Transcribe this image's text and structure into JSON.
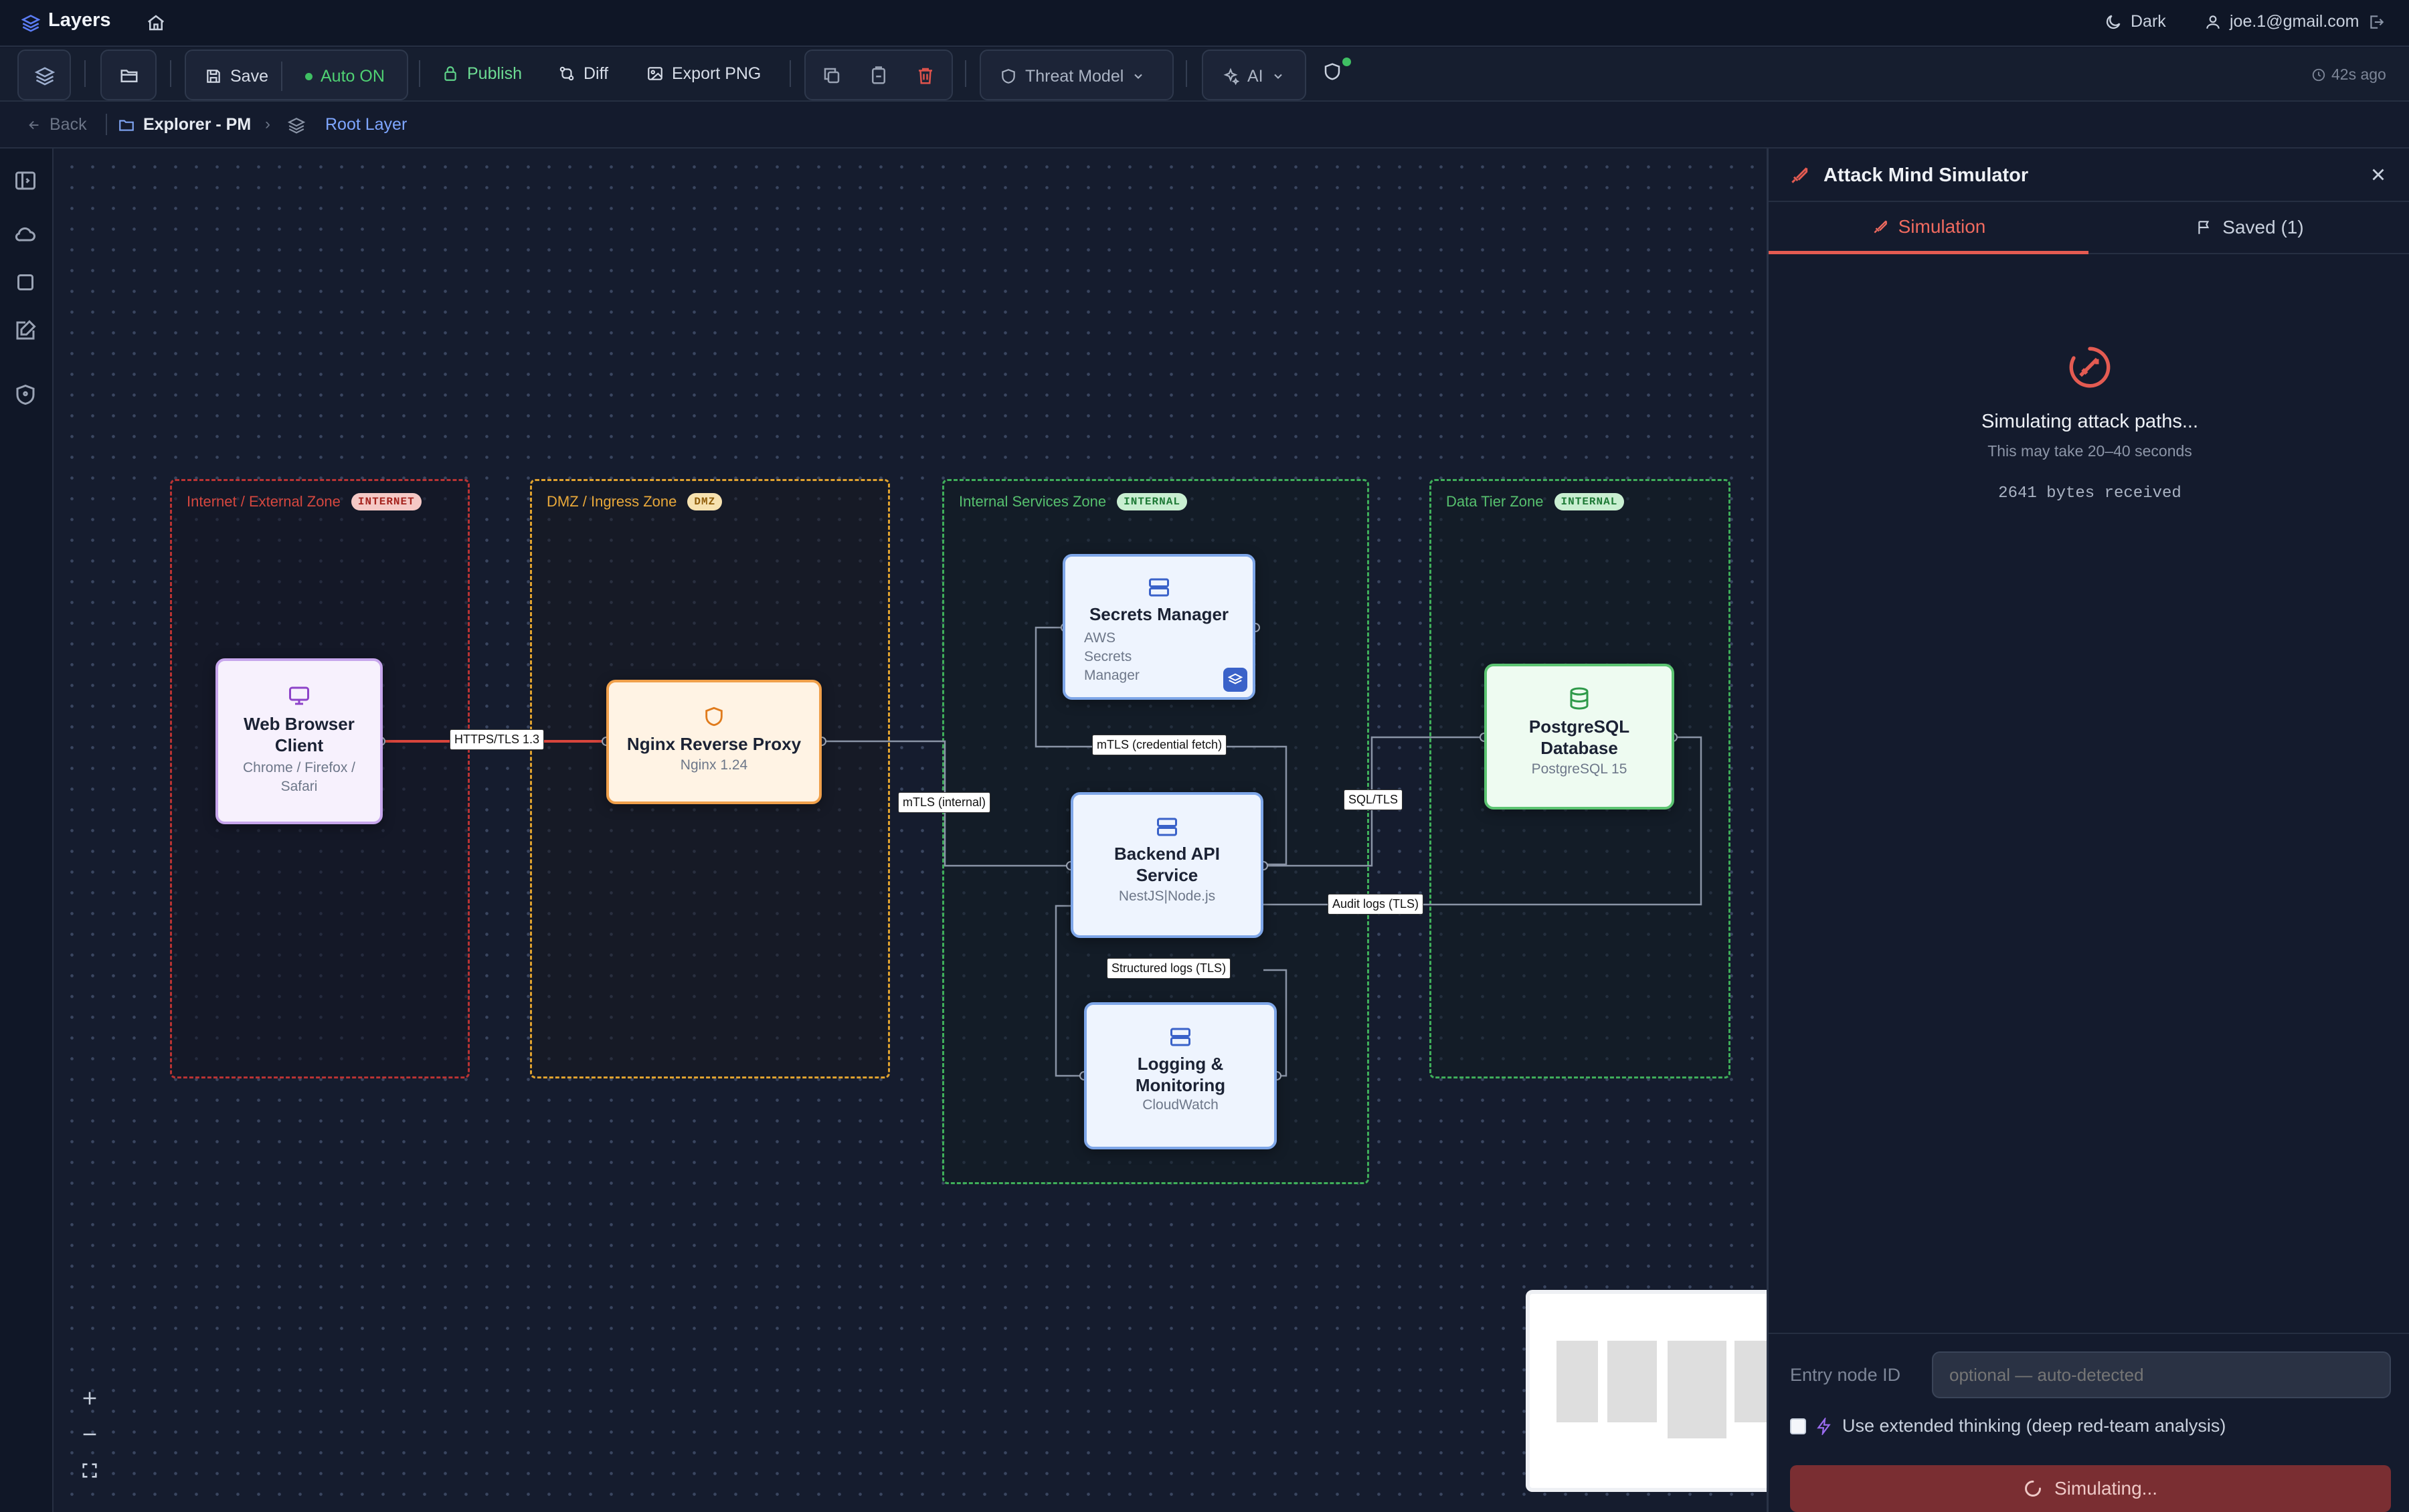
{
  "app": {
    "name": "Layers"
  },
  "header": {
    "theme_label": "Dark",
    "user_email": "joe.1@gmail.com"
  },
  "toolbar": {
    "save_label": "Save",
    "auto_label": "Auto ON",
    "publish_label": "Publish",
    "diff_label": "Diff",
    "export_label": "Export PNG",
    "threat_model_label": "Threat Model",
    "ai_label": "AI",
    "last_saved": "42s ago"
  },
  "breadcrumb": {
    "back_label": "Back",
    "project": "Explorer - PM",
    "layer": "Root Layer"
  },
  "zones": [
    {
      "label": "Internet / External Zone",
      "badge": "INTERNET"
    },
    {
      "label": "DMZ / Ingress Zone",
      "badge": "DMZ"
    },
    {
      "label": "Internal Services Zone",
      "badge": "INTERNAL"
    },
    {
      "label": "Data Tier Zone",
      "badge": "INTERNAL"
    }
  ],
  "nodes": {
    "browser": {
      "title": "Web Browser Client",
      "subtitle": "Chrome / Firefox / Safari"
    },
    "nginx": {
      "title": "Nginx Reverse Proxy",
      "subtitle": "Nginx 1.24"
    },
    "secrets": {
      "title": "Secrets Manager",
      "subtitle": "AWS Secrets Manager"
    },
    "backend": {
      "title": "Backend API Service",
      "subtitle": "NestJS|Node.js"
    },
    "logging": {
      "title": "Logging & Monitoring",
      "subtitle": "CloudWatch"
    },
    "postgres": {
      "title": "PostgreSQL Database",
      "subtitle": "PostgreSQL 15"
    }
  },
  "edges": {
    "https": "HTTPS/TLS 1.3",
    "mtls_internal": "mTLS (internal)",
    "mtls_cred": "mTLS (credential fetch)",
    "sql": "SQL/TLS",
    "audit": "Audit logs (TLS)",
    "structured": "Structured logs (TLS)"
  },
  "panel": {
    "title": "Attack Mind Simulator",
    "tab_simulation": "Simulation",
    "tab_saved": "Saved (1)",
    "status_title": "Simulating attack paths...",
    "status_sub": "This may take 20–40 seconds",
    "bytes": "2641 bytes received",
    "entry_label": "Entry node ID",
    "entry_placeholder": "optional — auto-detected",
    "extended_label": "Use extended thinking (deep red-team analysis)",
    "run_label": "Simulating..."
  },
  "colors": {
    "accent_red": "#e45b52",
    "internet_zone": "#c23b3b",
    "dmz_zone": "#e0a22f",
    "internal_zone": "#3fae5a",
    "node_blue": "#7ea6e8",
    "node_green": "#5cc472",
    "node_orange": "#f0a04b",
    "node_purple": "#c7a6ec"
  }
}
